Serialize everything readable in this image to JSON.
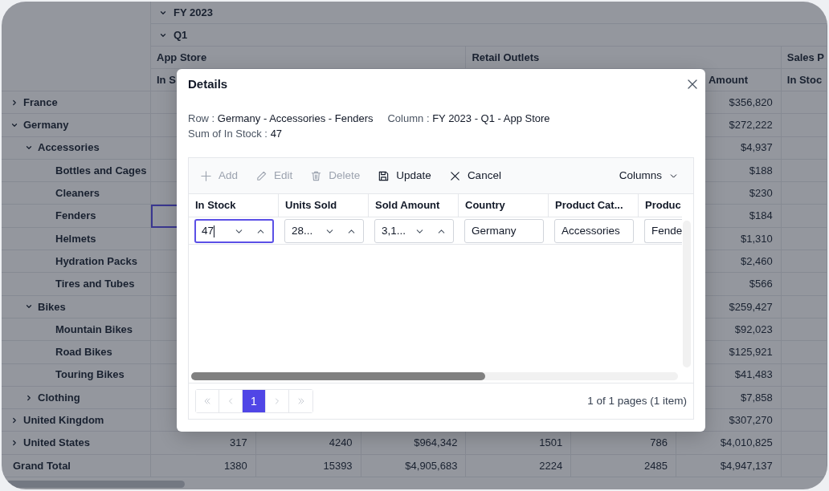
{
  "pivot": {
    "year": {
      "label": "FY 2023",
      "expanded": true
    },
    "quarter": {
      "label": "Q1",
      "expanded": true
    },
    "channels": [
      {
        "label": "App Store",
        "measures": [
          "In S"
        ]
      },
      {
        "label": "Retail Outlets",
        "measures": [
          "Amount"
        ]
      },
      {
        "label": "Sales P",
        "measures": [
          "In Stoc"
        ]
      }
    ],
    "rows": [
      {
        "label": "France",
        "expanded": false,
        "selected": false,
        "cells": [
          null,
          null,
          null,
          null,
          null,
          "$356,820"
        ]
      },
      {
        "label": "Germany",
        "expanded": true,
        "selected": false,
        "cells": [
          null,
          null,
          null,
          null,
          null,
          "$272,222"
        ],
        "children": [
          {
            "label": "Accessories",
            "expanded": true,
            "selected": false,
            "cells": [
              null,
              null,
              null,
              null,
              null,
              "$4,937"
            ],
            "children": [
              {
                "label": "Bottles and Cages",
                "selected": false,
                "cells": [
                  null,
                  null,
                  null,
                  null,
                  null,
                  "$188"
                ]
              },
              {
                "label": "Cleaners",
                "selected": false,
                "cells": [
                  null,
                  null,
                  null,
                  null,
                  null,
                  "$230"
                ]
              },
              {
                "label": "Fenders",
                "selected": true,
                "cells": [
                  null,
                  null,
                  null,
                  null,
                  null,
                  "$184"
                ]
              },
              {
                "label": "Helmets",
                "selected": false,
                "cells": [
                  null,
                  null,
                  null,
                  null,
                  null,
                  "$1,310"
                ]
              },
              {
                "label": "Hydration Packs",
                "selected": false,
                "cells": [
                  null,
                  null,
                  null,
                  null,
                  null,
                  "$2,460"
                ]
              },
              {
                "label": "Tires and Tubes",
                "selected": false,
                "cells": [
                  null,
                  null,
                  null,
                  null,
                  null,
                  "$566"
                ]
              }
            ]
          },
          {
            "label": "Bikes",
            "expanded": true,
            "selected": false,
            "cells": [
              null,
              null,
              null,
              null,
              null,
              "$259,427"
            ],
            "children": [
              {
                "label": "Mountain Bikes",
                "selected": false,
                "cells": [
                  null,
                  null,
                  null,
                  null,
                  null,
                  "$92,023"
                ]
              },
              {
                "label": "Road Bikes",
                "selected": false,
                "cells": [
                  null,
                  null,
                  null,
                  null,
                  null,
                  "$125,921"
                ]
              },
              {
                "label": "Touring Bikes",
                "selected": false,
                "cells": [
                  null,
                  null,
                  null,
                  null,
                  null,
                  "$41,483"
                ]
              }
            ]
          },
          {
            "label": "Clothing",
            "expanded": false,
            "selected": false,
            "cells": [
              null,
              null,
              null,
              null,
              null,
              "$7,858"
            ]
          }
        ]
      },
      {
        "label": "United Kingdom",
        "expanded": false,
        "selected": false,
        "cells": [
          null,
          null,
          null,
          null,
          null,
          "$307,270"
        ]
      },
      {
        "label": "United States",
        "expanded": false,
        "selected": false,
        "cells": [
          "317",
          "4240",
          "$964,342",
          "1501",
          "786",
          "$4,010,825"
        ]
      }
    ],
    "grand_total": {
      "label": "Grand Total",
      "cells": [
        "1380",
        "15393",
        "$4,905,683",
        "2224",
        "2485",
        "$4,947,137"
      ]
    }
  },
  "details_dialog": {
    "title": "Details",
    "info_lines": [
      {
        "items": [
          {
            "label": "Row :",
            "value": "Germany - Accessories - Fenders"
          },
          {
            "label": "Column :",
            "value": "FY 2023 - Q1 - App Store"
          }
        ]
      },
      {
        "items": [
          {
            "label": "Sum of In Stock :",
            "value": "47"
          }
        ]
      }
    ],
    "toolbar": [
      {
        "kind": "add",
        "label": "Add",
        "disabled": true
      },
      {
        "kind": "edit",
        "label": "Edit",
        "disabled": true
      },
      {
        "kind": "delete",
        "label": "Delete",
        "disabled": true
      },
      {
        "kind": "update",
        "label": "Update",
        "disabled": false
      },
      {
        "kind": "cancel",
        "label": "Cancel",
        "disabled": false
      },
      {
        "kind": "columns",
        "label": "Columns",
        "disabled": false
      }
    ],
    "columns": [
      "In Stock",
      "Units Sold",
      "Sold Amount",
      "Country",
      "Product Cat...",
      "Produc"
    ],
    "edit_row": [
      {
        "kind": "numeric",
        "value": "47",
        "focused": true
      },
      {
        "kind": "numeric",
        "value": "28...",
        "focused": false
      },
      {
        "kind": "numeric",
        "value": "3,1...",
        "focused": false
      },
      {
        "kind": "text",
        "value": "Germany",
        "focused": false
      },
      {
        "kind": "text",
        "value": "Accessories",
        "focused": false
      },
      {
        "kind": "text",
        "value": "Fende",
        "focused": false
      }
    ],
    "pager": {
      "nav": [
        {
          "kind": "first",
          "disabled": true
        },
        {
          "kind": "prev",
          "disabled": true
        }
      ],
      "pages": [
        {
          "label": "1",
          "selected": true
        }
      ],
      "nav_after": [
        {
          "kind": "next",
          "disabled": true
        },
        {
          "kind": "last",
          "disabled": true
        }
      ],
      "summary": "1 of 1 pages (1 item)"
    }
  }
}
